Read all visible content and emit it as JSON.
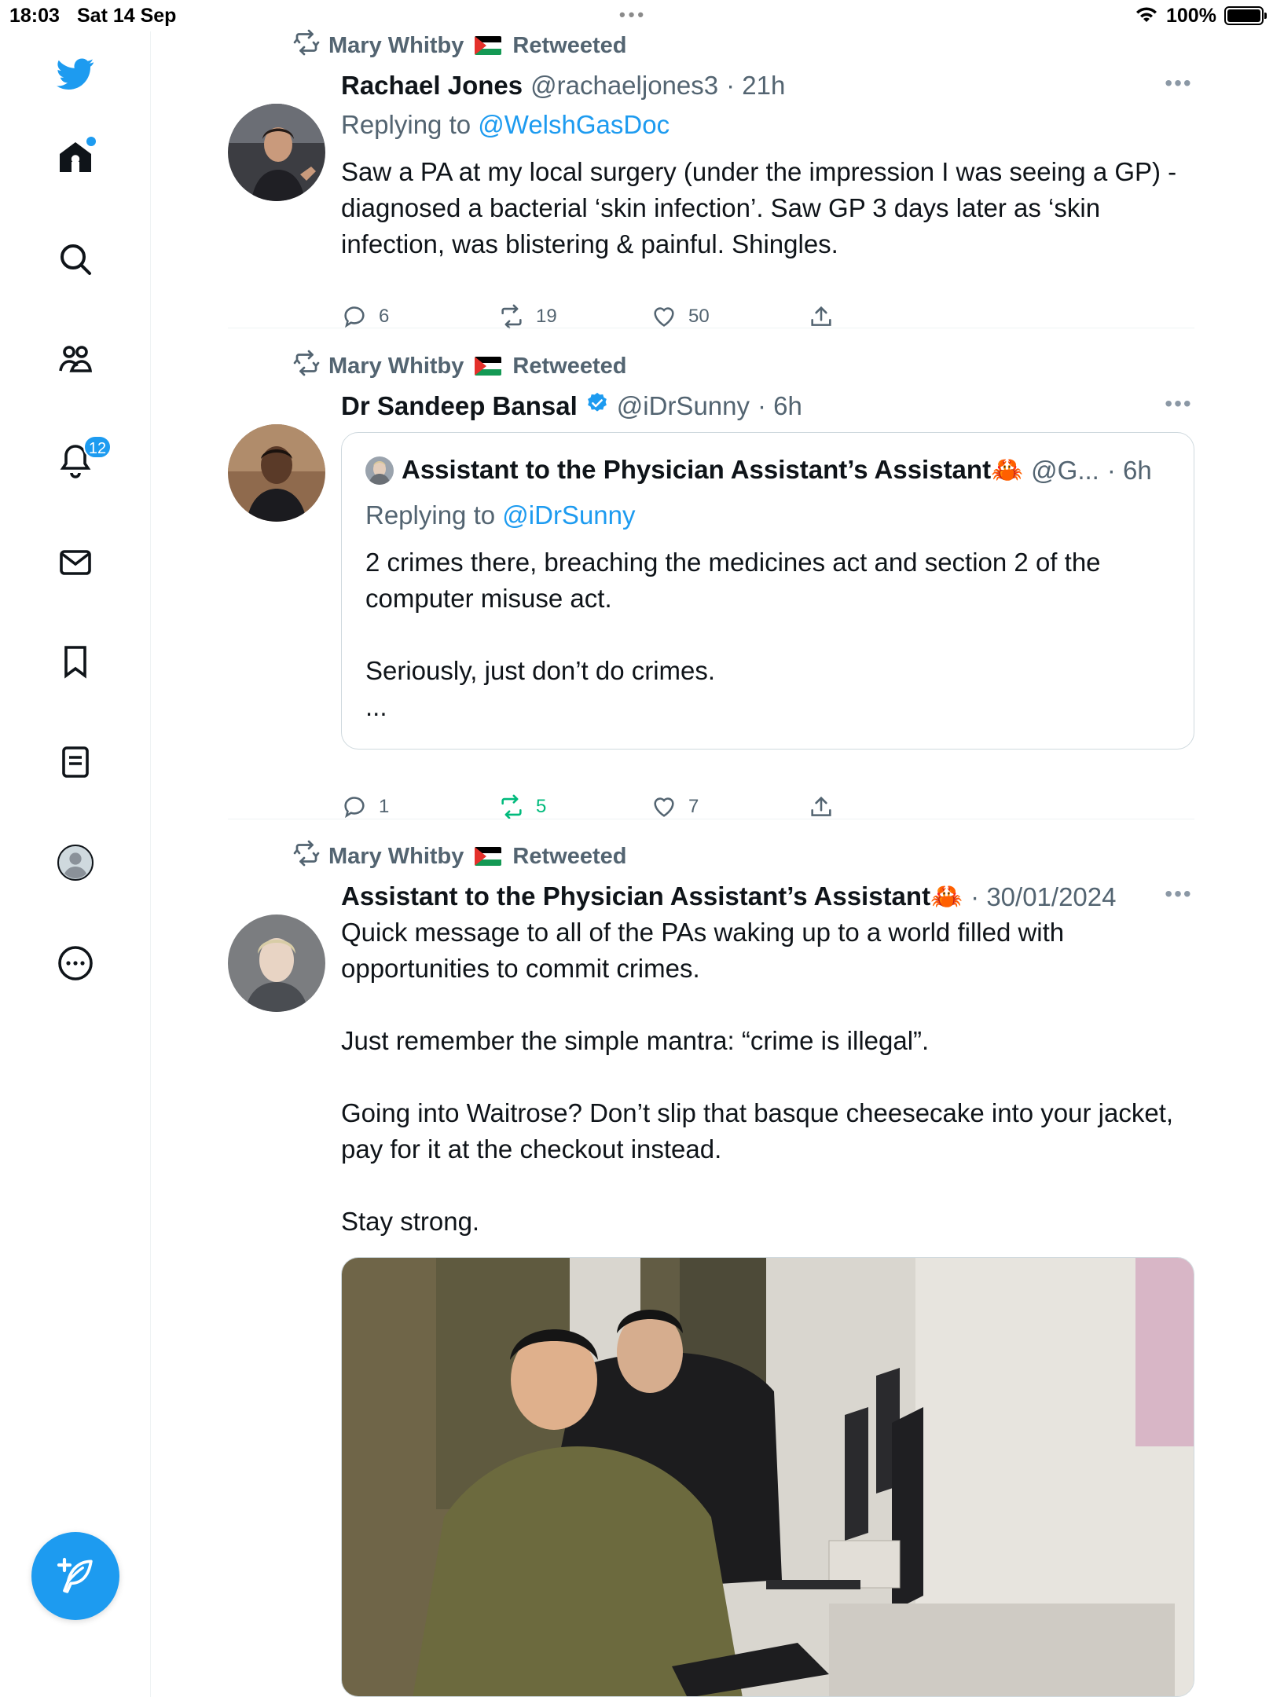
{
  "status_bar": {
    "time": "18:03",
    "date": "Sat 14 Sep",
    "handle_dots": "•••",
    "battery": "100%"
  },
  "sidebar": {
    "items": [
      {
        "name": "twitter-bird-icon"
      },
      {
        "name": "home-icon"
      },
      {
        "name": "search-icon"
      },
      {
        "name": "communities-icon"
      },
      {
        "name": "notifications-icon",
        "badge": "12"
      },
      {
        "name": "messages-icon"
      },
      {
        "name": "bookmarks-icon"
      },
      {
        "name": "lists-icon"
      },
      {
        "name": "profile-icon"
      },
      {
        "name": "more-icon"
      }
    ],
    "compose_icon": "compose-feather-icon"
  },
  "feed": {
    "tweets": [
      {
        "retweeted_by": "Mary Whitby",
        "retweeted_label": "Retweeted",
        "author": "Rachael Jones",
        "handle": "@rachaeljones3",
        "time": "· 21h",
        "replying_to_label": "Replying to",
        "replying_to": "@WelshGasDoc",
        "text": "Saw a PA at my local surgery (under the impression I was seeing a GP) - diagnosed a bacterial ‘skin infection’. Saw GP 3 days later as ‘skin infection, was blistering & painful. Shingles.",
        "replies": "6",
        "retweets": "19",
        "likes": "50"
      },
      {
        "retweeted_by": "Mary Whitby",
        "retweeted_label": "Retweeted",
        "author": "Dr Sandeep Bansal",
        "handle": "@iDrSunny",
        "time": "· 6h",
        "quote": {
          "author": "Assistant to the Physician Assistant’s Assistant🦀",
          "handle": "@G...",
          "time": "· 6h",
          "replying_to_label": "Replying to",
          "replying_to": "@iDrSunny",
          "text": "2 crimes there, breaching the medicines act and section 2 of the computer misuse act.\n\nSeriously, just don’t do crimes.\n..."
        },
        "replies": "1",
        "retweets": "5",
        "likes": "7"
      },
      {
        "retweeted_by": "Mary Whitby",
        "retweeted_label": "Retweeted",
        "author": "Assistant to the Physician Assistant’s Assistant🦀",
        "time": "· 30/01/2024",
        "text": "Quick message to all of the PAs waking up to a world filled with opportunities to commit crimes.\n\nJust remember the simple mantra: “crime is illegal”.\n\nGoing into Waitrose? Don’t slip that basque cheesecake into your jacket, pay for it at the checkout instead.\n\nStay strong."
      }
    ]
  },
  "colors": {
    "accent": "#1d9bf0",
    "secondary_text": "#536471",
    "retweet_green": "#00ba7c"
  }
}
